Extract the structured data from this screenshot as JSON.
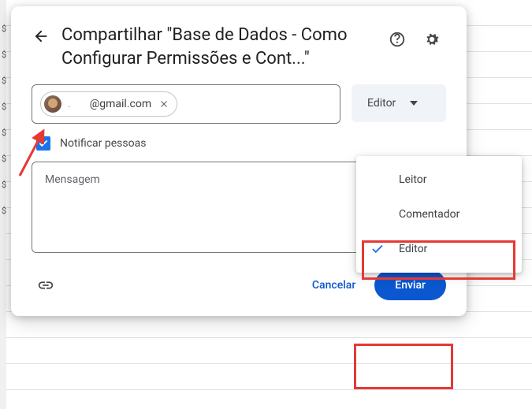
{
  "dialog": {
    "title": "Compartilhar \"Base de Dados - Como Configurar Permissões e Cont...\"",
    "chip_email": "@gmail.com",
    "role_selected": "Editor",
    "notify_label": "Notificar pessoas",
    "message_placeholder": "Mensagem",
    "cancel_label": "Cancelar",
    "send_label": "Enviar"
  },
  "dropdown": {
    "options": [
      "Leitor",
      "Comentador",
      "Editor"
    ],
    "selected_index": 2
  }
}
